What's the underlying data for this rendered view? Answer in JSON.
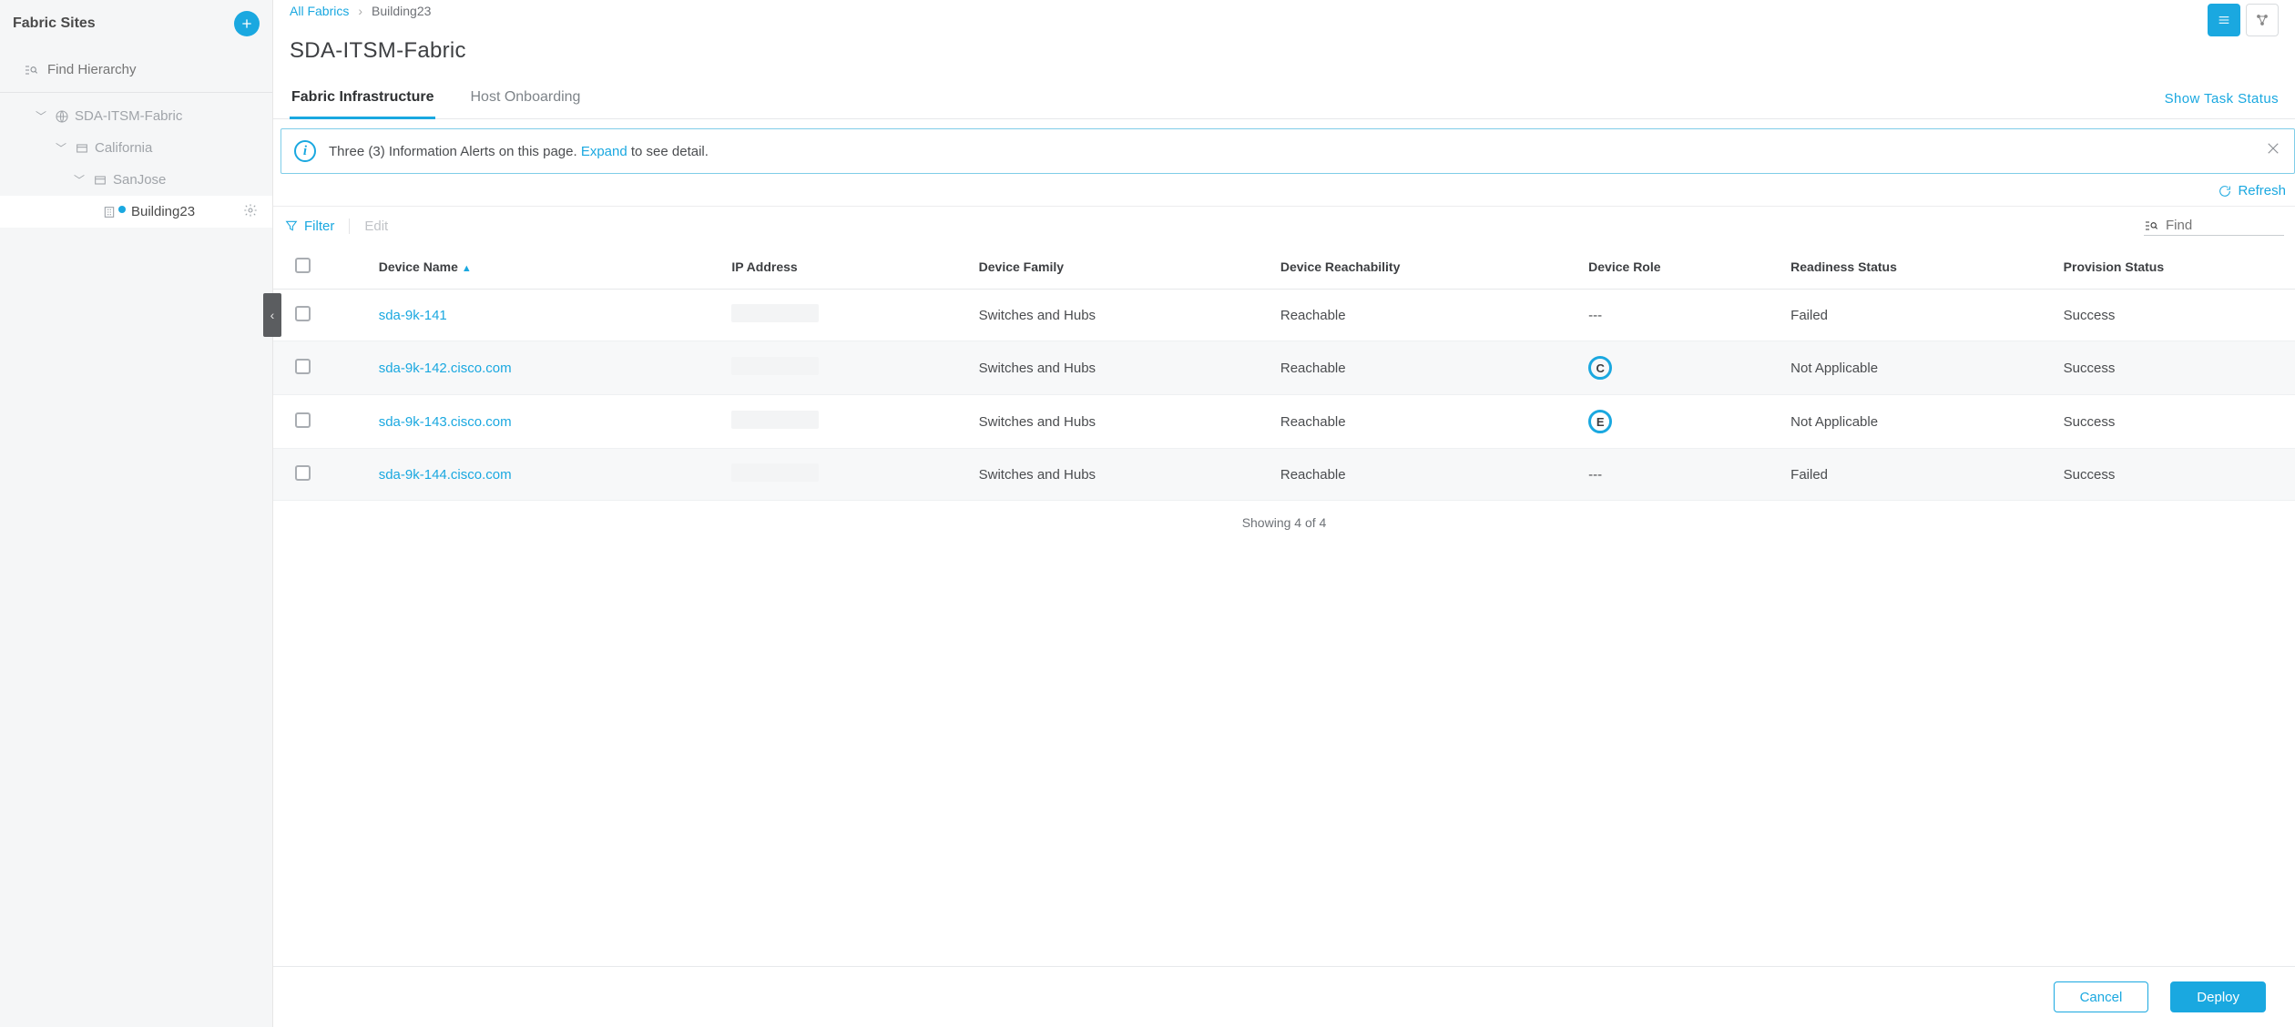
{
  "sidebar": {
    "title": "Fabric Sites",
    "find_placeholder": "Find Hierarchy",
    "tree": {
      "root": {
        "label": "SDA-ITSM-Fabric"
      },
      "l1": {
        "label": "California"
      },
      "l2": {
        "label": "SanJose"
      },
      "leaf": {
        "label": "Building23"
      }
    }
  },
  "breadcrumb": {
    "root": "All Fabrics",
    "current": "Building23"
  },
  "page_title": "SDA-ITSM-Fabric",
  "tabs": {
    "infra": "Fabric Infrastructure",
    "host": "Host Onboarding"
  },
  "task_status": "Show Task Status",
  "alert": {
    "text_pre": "Three (3) Information Alerts on this page. ",
    "link": "Expand",
    "text_post": " to see detail."
  },
  "refresh": "Refresh",
  "toolbar": {
    "filter": "Filter",
    "edit": "Edit",
    "find_placeholder": "Find"
  },
  "table": {
    "headers": {
      "name": "Device Name",
      "ip": "IP Address",
      "family": "Device Family",
      "reach": "Device Reachability",
      "role": "Device Role",
      "ready": "Readiness Status",
      "prov": "Provision Status"
    },
    "rows": [
      {
        "name": "sda-9k-141",
        "ip": "",
        "family": "Switches and Hubs",
        "reach": "Reachable",
        "role": "---",
        "role_badge": "",
        "ready": "Failed",
        "prov": "Success"
      },
      {
        "name": "sda-9k-142.cisco.com",
        "ip": "",
        "family": "Switches and Hubs",
        "reach": "Reachable",
        "role": "",
        "role_badge": "C",
        "ready": "Not Applicable",
        "prov": "Success"
      },
      {
        "name": "sda-9k-143.cisco.com",
        "ip": "",
        "family": "Switches and Hubs",
        "reach": "Reachable",
        "role": "",
        "role_badge": "E",
        "ready": "Not Applicable",
        "prov": "Success"
      },
      {
        "name": "sda-9k-144.cisco.com",
        "ip": "",
        "family": "Switches and Hubs",
        "reach": "Reachable",
        "role": "---",
        "role_badge": "",
        "ready": "Failed",
        "prov": "Success"
      }
    ],
    "summary": "Showing 4 of 4"
  },
  "footer": {
    "cancel": "Cancel",
    "deploy": "Deploy"
  }
}
